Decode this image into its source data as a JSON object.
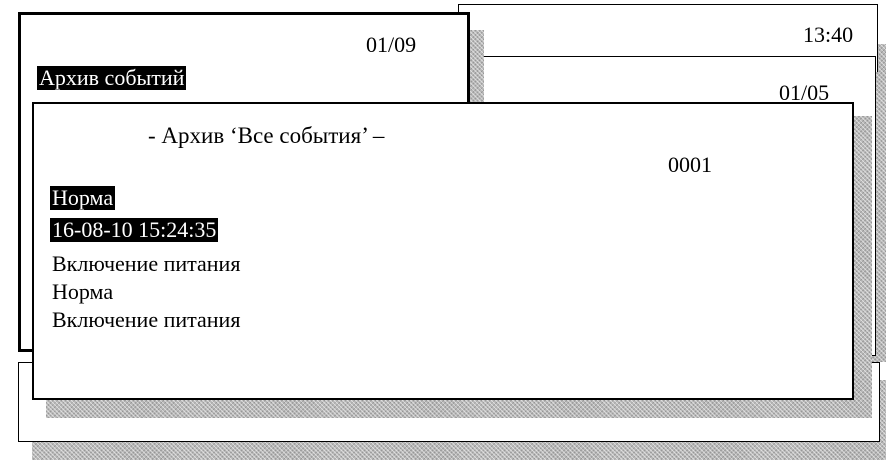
{
  "screen_back_right": {
    "time": "13:40",
    "page": "01/05"
  },
  "screen_menu": {
    "page": "01/09",
    "selected_item": "Архив событий"
  },
  "archive_dialog": {
    "title": "- Архив ‘Все события’ –",
    "record_number": "0001",
    "events": [
      {
        "text": "Норма",
        "highlighted": true
      },
      {
        "text": "16-08-10 15:24:35",
        "highlighted": true
      },
      {
        "text": "Включение питания",
        "highlighted": false
      },
      {
        "text": "Норма",
        "highlighted": false
      },
      {
        "text": "Включение питания",
        "highlighted": false
      }
    ]
  },
  "colors": {
    "frame_border": "#000000",
    "highlight_bg": "#000000",
    "highlight_fg": "#ffffff",
    "shadow": "#b8b8b8"
  }
}
